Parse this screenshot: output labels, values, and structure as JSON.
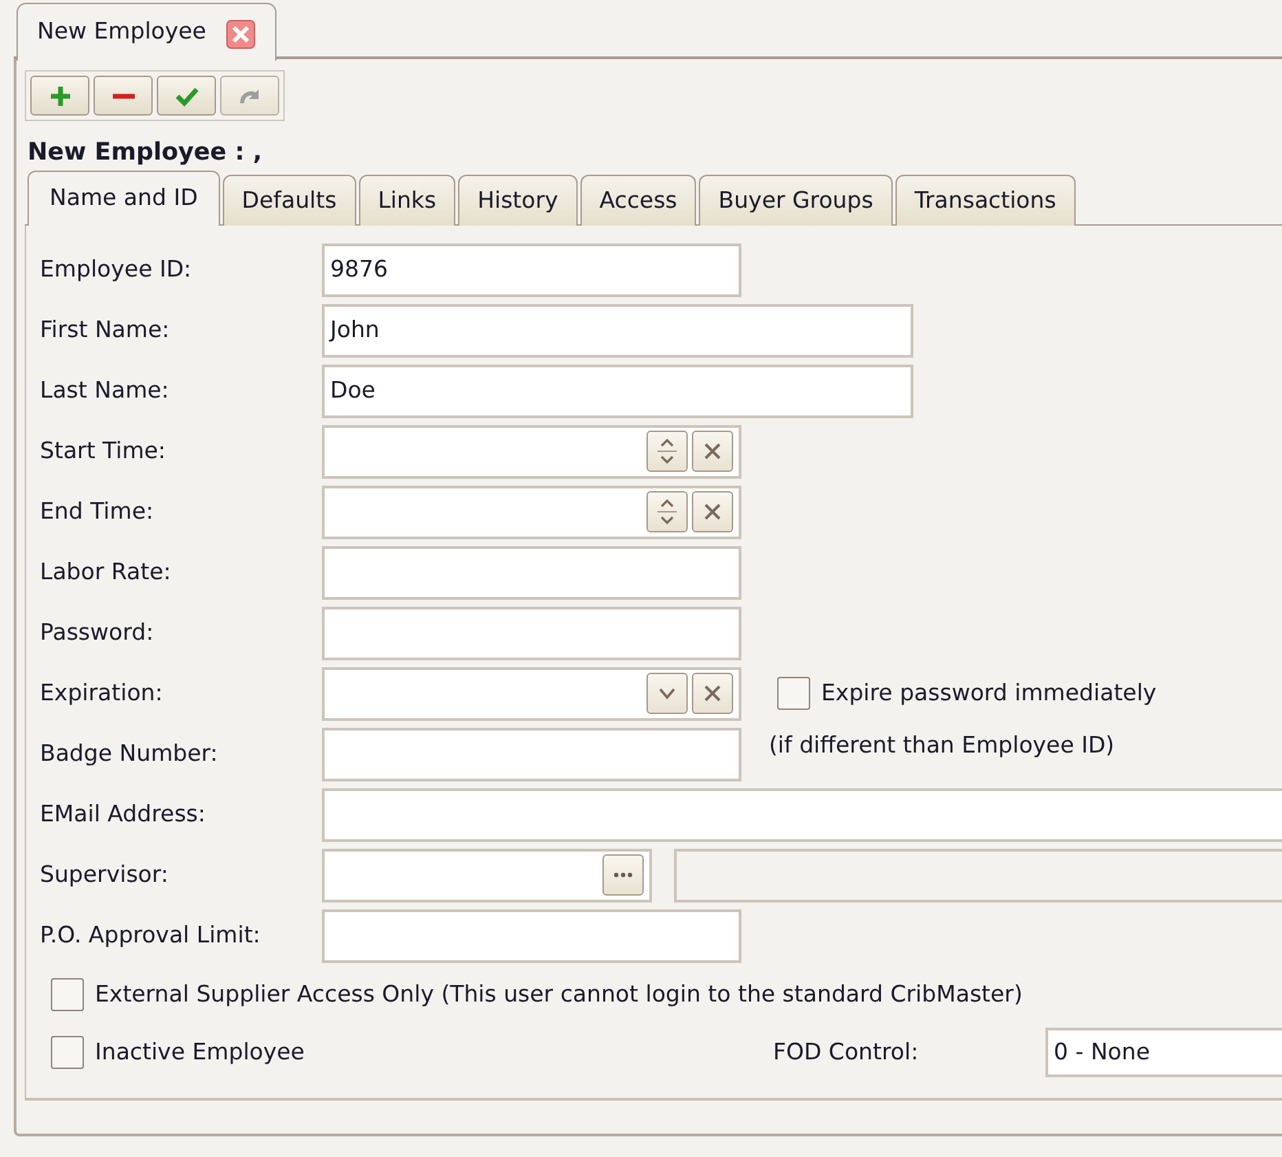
{
  "doc_tab": {
    "label": "New Employee",
    "selected": true
  },
  "toolbar": [
    {
      "kind": "add",
      "disabled": false
    },
    {
      "kind": "remove",
      "disabled": false
    },
    {
      "kind": "save",
      "disabled": false
    },
    {
      "kind": "redo",
      "disabled": true
    }
  ],
  "heading": "New Employee : ,",
  "tabs": [
    {
      "label": "Name and ID",
      "selected": true
    },
    {
      "label": "Defaults",
      "selected": false
    },
    {
      "label": "Links",
      "selected": false
    },
    {
      "label": "History",
      "selected": false
    },
    {
      "label": "Access",
      "selected": false
    },
    {
      "label": "Buyer Groups",
      "selected": false
    },
    {
      "label": "Transactions",
      "selected": false
    }
  ],
  "fields": [
    {
      "kind": "short",
      "label": "Employee ID:",
      "value": "9876"
    },
    {
      "kind": "medium",
      "label": "First Name:",
      "value": "John"
    },
    {
      "kind": "medium",
      "label": "Last Name:",
      "value": "Doe"
    },
    {
      "kind": "time",
      "label": "Start Time:"
    },
    {
      "kind": "time",
      "label": "End Time:"
    },
    {
      "kind": "short",
      "label": "Labor Rate:"
    },
    {
      "kind": "short",
      "label": "Password:"
    },
    {
      "kind": "date",
      "label": "Expiration:",
      "checkbox": {
        "label": "Expire password immediately",
        "checked": false
      }
    },
    {
      "kind": "short",
      "label": "Badge Number:",
      "note": "(if different than Employee ID)"
    },
    {
      "kind": "full",
      "label": "EMail Address:"
    },
    {
      "kind": "lookup",
      "label": "Supervisor:"
    },
    {
      "kind": "short",
      "label": "P.O. Approval Limit:"
    }
  ],
  "options": [
    {
      "label": "External Supplier Access Only (This user cannot login to the standard CribMaster)",
      "checked": false
    },
    {
      "label": "Inactive Employee",
      "checked": false
    }
  ],
  "fod_control": {
    "label": "FOD Control:",
    "value": "0 - None"
  }
}
